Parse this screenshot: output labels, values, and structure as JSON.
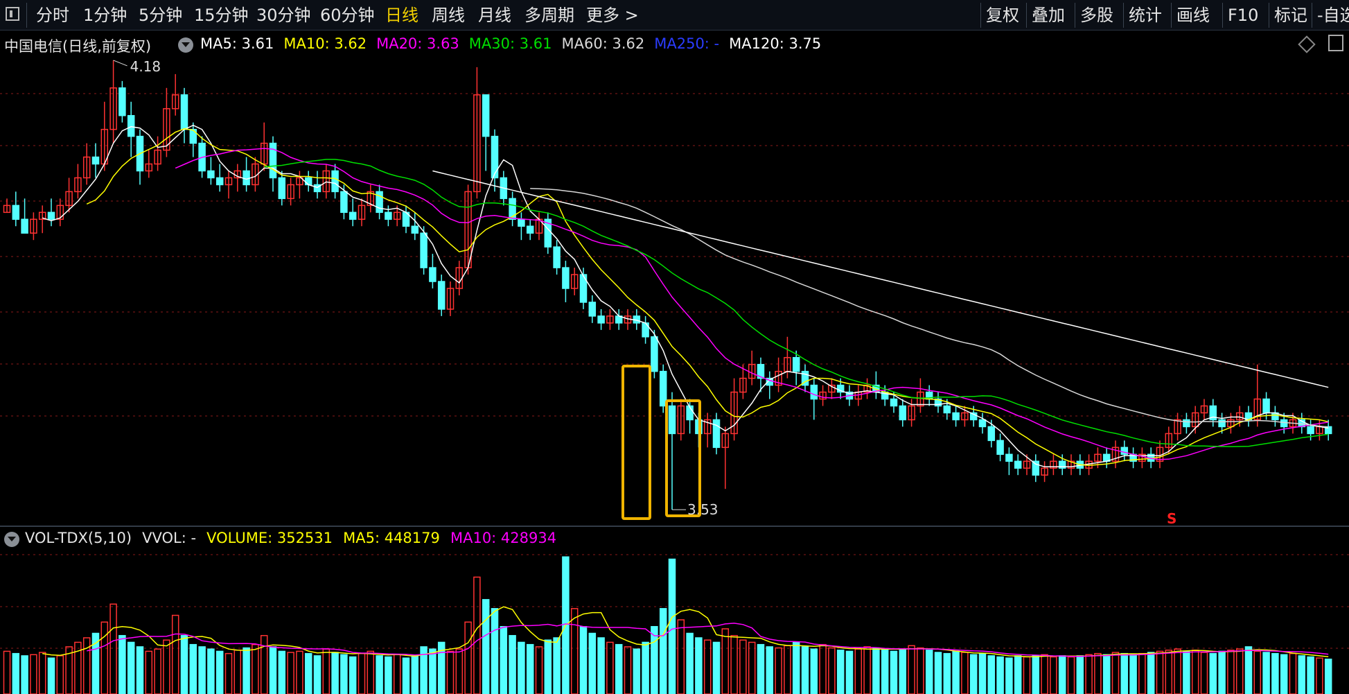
{
  "toolbar": {
    "left_items": [
      "分时",
      "1分钟",
      "5分钟",
      "15分钟",
      "30分钟",
      "60分钟",
      "日线",
      "周线",
      "月线",
      "多周期",
      "更多 >"
    ],
    "active": "日线",
    "right_items": [
      "复权",
      "叠加",
      "多股",
      "统计",
      "画线",
      "F10",
      "标记",
      "-自选"
    ]
  },
  "legend": {
    "title": "中国电信(日线,前复权)",
    "ma": [
      {
        "label": "MA5: 3.61",
        "color": "#ffffff"
      },
      {
        "label": "MA10: 3.62",
        "color": "#ffff00"
      },
      {
        "label": "MA20: 3.63",
        "color": "#ff00ff"
      },
      {
        "label": "MA30: 3.61",
        "color": "#00e000"
      },
      {
        "label": "MA60: 3.62",
        "color": "#d8d8d8"
      },
      {
        "label": "MA250: -",
        "color": "#2a3cff"
      },
      {
        "label": "MA120: 3.75",
        "color": "#ffffff"
      }
    ]
  },
  "vol_legend": {
    "name": "VOL-TDX(5,10)",
    "vvol": "VVOL: -",
    "volume": "VOLUME: 352531",
    "ma5": "MA5: 448179",
    "ma10": "MA10: 428934",
    "colors": {
      "volume": "#ffff00",
      "ma5": "#ffff00",
      "ma10": "#ff00ff"
    }
  },
  "annotations": {
    "high_label": "4.18",
    "low_label": "3.53",
    "signal": "S"
  },
  "colors": {
    "up": "#ff3232",
    "down": "#54ffff",
    "background": "#000000",
    "grid": "#8b1a1a",
    "highlight": "#f0b400",
    "ma120": "#ffffff",
    "ma60": "#d8d8d8"
  },
  "chart_data": {
    "type": "candlestick",
    "title": "中国电信(日线,前复权)",
    "y_high": 4.18,
    "y_low": 3.53,
    "candles": [
      [
        3.96,
        3.97,
        3.98,
        3.96
      ],
      [
        3.97,
        3.95,
        3.99,
        3.94
      ],
      [
        3.95,
        3.93,
        3.98,
        3.93
      ],
      [
        3.93,
        3.95,
        3.96,
        3.92
      ],
      [
        3.95,
        3.96,
        3.97,
        3.93
      ],
      [
        3.96,
        3.95,
        3.98,
        3.94
      ],
      [
        3.95,
        3.97,
        3.98,
        3.94
      ],
      [
        3.97,
        3.99,
        4.01,
        3.96
      ],
      [
        3.99,
        4.01,
        4.03,
        3.98
      ],
      [
        4.01,
        4.04,
        4.06,
        4.0
      ],
      [
        4.04,
        4.03,
        4.06,
        4.01
      ],
      [
        4.03,
        4.08,
        4.12,
        4.02
      ],
      [
        4.08,
        4.14,
        4.18,
        4.06
      ],
      [
        4.14,
        4.1,
        4.15,
        4.09
      ],
      [
        4.1,
        4.07,
        4.12,
        4.04
      ],
      [
        4.07,
        4.02,
        4.08,
        4.0
      ],
      [
        4.02,
        4.03,
        4.05,
        4.01
      ],
      [
        4.03,
        4.05,
        4.07,
        4.02
      ],
      [
        4.05,
        4.11,
        4.14,
        4.04
      ],
      [
        4.11,
        4.13,
        4.16,
        4.1
      ],
      [
        4.13,
        4.08,
        4.14,
        4.06
      ],
      [
        4.08,
        4.06,
        4.09,
        4.04
      ],
      [
        4.06,
        4.02,
        4.07,
        4.01
      ],
      [
        4.02,
        4.01,
        4.04,
        4.0
      ],
      [
        4.01,
        4.0,
        4.03,
        3.99
      ],
      [
        4.0,
        4.01,
        4.02,
        3.98
      ],
      [
        4.01,
        4.02,
        4.03,
        3.99
      ],
      [
        4.02,
        4.0,
        4.04,
        3.99
      ],
      [
        4.0,
        4.03,
        4.04,
        3.99
      ],
      [
        4.03,
        4.06,
        4.09,
        4.02
      ],
      [
        4.06,
        4.01,
        4.07,
        3.99
      ],
      [
        4.01,
        3.98,
        4.02,
        3.97
      ],
      [
        3.98,
        4.0,
        4.01,
        3.97
      ],
      [
        4.0,
        4.01,
        4.02,
        3.98
      ],
      [
        4.01,
        4.0,
        4.02,
        3.99
      ],
      [
        4.0,
        3.99,
        4.02,
        3.98
      ],
      [
        3.99,
        4.02,
        4.03,
        3.98
      ],
      [
        4.02,
        3.99,
        4.03,
        3.98
      ],
      [
        3.99,
        3.96,
        4.0,
        3.95
      ],
      [
        3.96,
        3.95,
        3.98,
        3.94
      ],
      [
        3.95,
        3.97,
        3.98,
        3.94
      ],
      [
        3.97,
        3.99,
        4.0,
        3.96
      ],
      [
        3.99,
        3.96,
        4.0,
        3.95
      ],
      [
        3.96,
        3.95,
        3.97,
        3.94
      ],
      [
        3.95,
        3.96,
        3.97,
        3.94
      ],
      [
        3.96,
        3.94,
        3.97,
        3.93
      ],
      [
        3.94,
        3.93,
        3.96,
        3.92
      ],
      [
        3.93,
        3.88,
        3.94,
        3.87
      ],
      [
        3.88,
        3.86,
        3.9,
        3.85
      ],
      [
        3.86,
        3.82,
        3.87,
        3.81
      ],
      [
        3.82,
        3.85,
        3.86,
        3.81
      ],
      [
        3.85,
        3.88,
        3.89,
        3.84
      ],
      [
        3.88,
        3.99,
        4.0,
        3.87
      ],
      [
        3.99,
        4.13,
        4.17,
        3.98
      ],
      [
        4.13,
        4.07,
        4.13,
        4.02
      ],
      [
        4.07,
        4.01,
        4.08,
        3.99
      ],
      [
        4.01,
        3.98,
        4.02,
        3.97
      ],
      [
        3.98,
        3.95,
        3.99,
        3.94
      ],
      [
        3.95,
        3.94,
        3.96,
        3.92
      ],
      [
        3.94,
        3.93,
        3.95,
        3.92
      ],
      [
        3.93,
        3.95,
        3.96,
        3.92
      ],
      [
        3.95,
        3.91,
        3.96,
        3.9
      ],
      [
        3.91,
        3.88,
        3.92,
        3.87
      ],
      [
        3.88,
        3.85,
        3.89,
        3.83
      ],
      [
        3.85,
        3.87,
        3.88,
        3.84
      ],
      [
        3.87,
        3.83,
        3.88,
        3.82
      ],
      [
        3.83,
        3.81,
        3.84,
        3.8
      ],
      [
        3.81,
        3.8,
        3.82,
        3.79
      ],
      [
        3.8,
        3.81,
        3.82,
        3.79
      ],
      [
        3.81,
        3.8,
        3.82,
        3.79
      ],
      [
        3.8,
        3.81,
        3.82,
        3.79
      ],
      [
        3.81,
        3.8,
        3.82,
        3.79
      ],
      [
        3.8,
        3.78,
        3.81,
        3.77
      ],
      [
        3.78,
        3.73,
        3.79,
        3.72
      ],
      [
        3.73,
        3.68,
        3.74,
        3.67
      ],
      [
        3.68,
        3.64,
        3.7,
        3.53
      ],
      [
        3.64,
        3.68,
        3.69,
        3.63
      ],
      [
        3.68,
        3.66,
        3.69,
        3.64
      ],
      [
        3.66,
        3.64,
        3.67,
        3.62
      ],
      [
        3.64,
        3.66,
        3.67,
        3.62
      ],
      [
        3.66,
        3.62,
        3.67,
        3.61
      ],
      [
        3.62,
        3.64,
        3.65,
        3.56
      ],
      [
        3.64,
        3.7,
        3.72,
        3.63
      ],
      [
        3.7,
        3.72,
        3.74,
        3.69
      ],
      [
        3.72,
        3.74,
        3.76,
        3.71
      ],
      [
        3.74,
        3.72,
        3.75,
        3.7
      ],
      [
        3.72,
        3.71,
        3.73,
        3.69
      ],
      [
        3.71,
        3.73,
        3.75,
        3.7
      ],
      [
        3.73,
        3.75,
        3.78,
        3.72
      ],
      [
        3.75,
        3.73,
        3.76,
        3.71
      ],
      [
        3.73,
        3.71,
        3.74,
        3.7
      ],
      [
        3.71,
        3.69,
        3.72,
        3.66
      ],
      [
        3.69,
        3.7,
        3.71,
        3.68
      ],
      [
        3.7,
        3.71,
        3.72,
        3.69
      ],
      [
        3.71,
        3.7,
        3.72,
        3.69
      ],
      [
        3.7,
        3.69,
        3.71,
        3.68
      ],
      [
        3.69,
        3.7,
        3.71,
        3.68
      ],
      [
        3.7,
        3.71,
        3.72,
        3.69
      ],
      [
        3.71,
        3.7,
        3.73,
        3.69
      ],
      [
        3.7,
        3.69,
        3.71,
        3.68
      ],
      [
        3.69,
        3.68,
        3.7,
        3.67
      ],
      [
        3.68,
        3.66,
        3.69,
        3.65
      ],
      [
        3.66,
        3.68,
        3.69,
        3.65
      ],
      [
        3.68,
        3.7,
        3.72,
        3.67
      ],
      [
        3.7,
        3.69,
        3.71,
        3.68
      ],
      [
        3.69,
        3.68,
        3.7,
        3.67
      ],
      [
        3.68,
        3.67,
        3.69,
        3.66
      ],
      [
        3.67,
        3.66,
        3.68,
        3.65
      ],
      [
        3.66,
        3.67,
        3.68,
        3.65
      ],
      [
        3.67,
        3.66,
        3.68,
        3.65
      ],
      [
        3.66,
        3.65,
        3.67,
        3.64
      ],
      [
        3.65,
        3.63,
        3.66,
        3.62
      ],
      [
        3.63,
        3.61,
        3.64,
        3.6
      ],
      [
        3.61,
        3.6,
        3.62,
        3.58
      ],
      [
        3.6,
        3.59,
        3.61,
        3.58
      ],
      [
        3.59,
        3.6,
        3.61,
        3.58
      ],
      [
        3.6,
        3.58,
        3.61,
        3.57
      ],
      [
        3.58,
        3.59,
        3.6,
        3.57
      ],
      [
        3.59,
        3.6,
        3.61,
        3.58
      ],
      [
        3.6,
        3.59,
        3.61,
        3.58
      ],
      [
        3.59,
        3.6,
        3.61,
        3.58
      ],
      [
        3.6,
        3.59,
        3.61,
        3.58
      ],
      [
        3.59,
        3.6,
        3.61,
        3.58
      ],
      [
        3.6,
        3.61,
        3.62,
        3.59
      ],
      [
        3.61,
        3.6,
        3.62,
        3.59
      ],
      [
        3.6,
        3.62,
        3.63,
        3.59
      ],
      [
        3.62,
        3.61,
        3.63,
        3.6
      ],
      [
        3.61,
        3.6,
        3.62,
        3.59
      ],
      [
        3.6,
        3.61,
        3.62,
        3.59
      ],
      [
        3.61,
        3.6,
        3.62,
        3.59
      ],
      [
        3.6,
        3.62,
        3.63,
        3.59
      ],
      [
        3.62,
        3.64,
        3.65,
        3.61
      ],
      [
        3.64,
        3.66,
        3.67,
        3.63
      ],
      [
        3.66,
        3.65,
        3.67,
        3.64
      ],
      [
        3.65,
        3.67,
        3.68,
        3.64
      ],
      [
        3.67,
        3.68,
        3.69,
        3.66
      ],
      [
        3.68,
        3.66,
        3.69,
        3.65
      ],
      [
        3.66,
        3.65,
        3.67,
        3.64
      ],
      [
        3.65,
        3.66,
        3.67,
        3.64
      ],
      [
        3.66,
        3.67,
        3.68,
        3.65
      ],
      [
        3.67,
        3.66,
        3.68,
        3.65
      ],
      [
        3.66,
        3.69,
        3.74,
        3.65
      ],
      [
        3.69,
        3.67,
        3.7,
        3.66
      ],
      [
        3.67,
        3.66,
        3.68,
        3.65
      ],
      [
        3.66,
        3.65,
        3.67,
        3.64
      ],
      [
        3.65,
        3.66,
        3.67,
        3.64
      ],
      [
        3.66,
        3.65,
        3.67,
        3.64
      ],
      [
        3.65,
        3.64,
        3.66,
        3.63
      ],
      [
        3.64,
        3.65,
        3.66,
        3.63
      ],
      [
        3.65,
        3.64,
        3.66,
        3.63
      ]
    ],
    "volume": [
      190,
      180,
      170,
      175,
      185,
      160,
      170,
      210,
      230,
      250,
      270,
      320,
      400,
      260,
      230,
      210,
      190,
      200,
      240,
      350,
      260,
      220,
      210,
      200,
      190,
      180,
      195,
      205,
      220,
      260,
      210,
      190,
      185,
      190,
      180,
      170,
      200,
      185,
      175,
      165,
      180,
      190,
      170,
      165,
      175,
      160,
      170,
      210,
      200,
      230,
      190,
      200,
      320,
      520,
      420,
      380,
      300,
      260,
      230,
      220,
      210,
      240,
      250,
      610,
      380,
      300,
      270,
      250,
      230,
      220,
      210,
      200,
      230,
      300,
      380,
      600,
      330,
      270,
      250,
      240,
      230,
      290,
      260,
      240,
      230,
      220,
      210,
      205,
      215,
      230,
      210,
      200,
      220,
      205,
      195,
      190,
      200,
      210,
      205,
      195,
      190,
      200,
      215,
      205,
      195,
      185,
      180,
      190,
      185,
      175,
      180,
      170,
      165,
      160,
      170,
      165,
      170,
      175,
      165,
      170,
      165,
      170,
      175,
      180,
      175,
      185,
      180,
      175,
      180,
      185,
      190,
      195,
      200,
      190,
      195,
      185,
      180,
      190,
      195,
      200,
      210,
      190,
      185,
      180,
      175,
      180,
      170,
      165,
      160,
      155
    ]
  }
}
